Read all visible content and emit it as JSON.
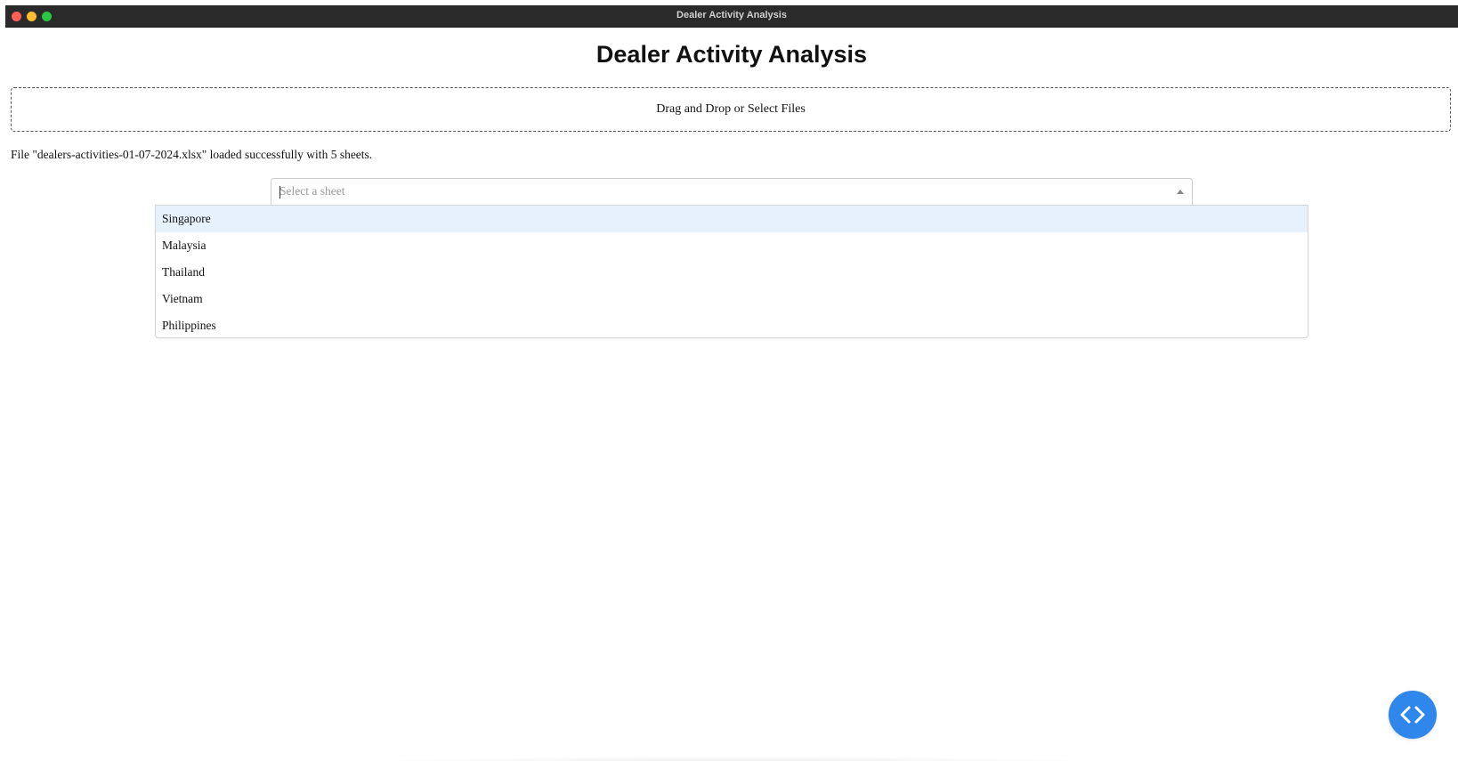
{
  "window": {
    "title": "Dealer Activity Analysis"
  },
  "page": {
    "title": "Dealer Activity Analysis"
  },
  "upload": {
    "label": "Drag and Drop or Select Files"
  },
  "status": {
    "message": "File \"dealers-activities-01-07-2024.xlsx\" loaded successfully with 5 sheets."
  },
  "sheet_select": {
    "placeholder": "Select a sheet",
    "options": [
      "Singapore",
      "Malaysia",
      "Thailand",
      "Vietnam",
      "Philippines"
    ],
    "focused_index": 0
  },
  "fab": {
    "icon": "code-icon"
  },
  "colors": {
    "accent": "#2f86eb",
    "option_hover": "#e6f1fc",
    "titlebar": "#2a2a2a"
  }
}
